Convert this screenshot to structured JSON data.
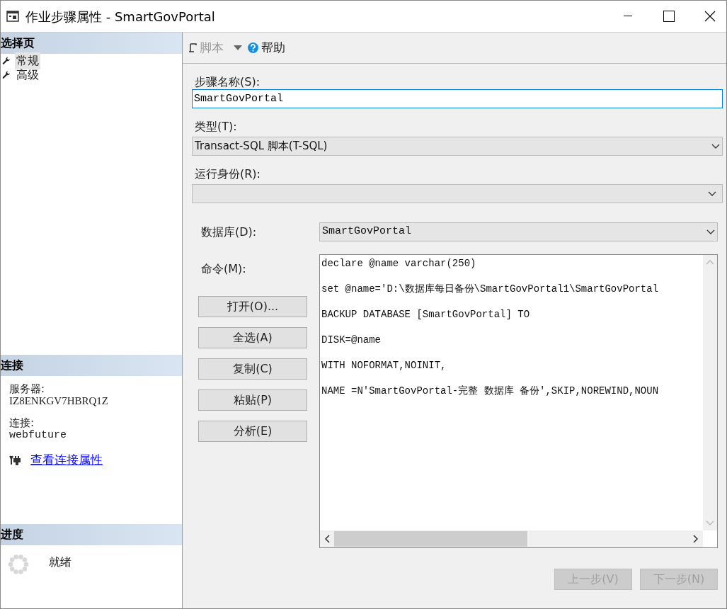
{
  "window": {
    "title": "作业步骤属性 - SmartGovPortal"
  },
  "sidebar": {
    "select_page": {
      "title": "选择页",
      "items": [
        {
          "label": "常规",
          "selected": true
        },
        {
          "label": "高级",
          "selected": false
        }
      ]
    },
    "connection": {
      "title": "连接",
      "server_label": "服务器:",
      "server": "IZ8ENKGV7HBRQ1Z",
      "connection_label": "连接:",
      "connection": "webfuture",
      "link": "查看连接属性"
    },
    "progress": {
      "title": "进度",
      "status": "就绪"
    }
  },
  "toolbar": [
    {
      "kind": "script",
      "label": "脚本",
      "disabled": true
    },
    {
      "kind": "help",
      "label": "帮助",
      "disabled": false
    }
  ],
  "form": {
    "step_name": {
      "label": "步骤名称(S):",
      "value": "SmartGovPortal"
    },
    "type": {
      "label": "类型(T):",
      "value": "Transact-SQL 脚本(T-SQL)"
    },
    "run_as": {
      "label": "运行身份(R):"
    },
    "database": {
      "label": "数据库(D):",
      "value": "SmartGovPortal"
    },
    "command": {
      "label": "命令(M):",
      "lines": [
        "declare @name varchar(250)",
        "set @name='D:\\数据库每日备份\\SmartGovPortal1\\SmartGovPortal",
        "BACKUP DATABASE [SmartGovPortal] TO",
        "DISK=@name",
        "WITH NOFORMAT,NOINIT,",
        "NAME =N'SmartGovPortal-完整 数据库 备份',SKIP,NOREWIND,NOUN"
      ]
    },
    "command_buttons": [
      "打开(O)...",
      "全选(A)",
      "复制(C)",
      "粘贴(P)",
      "分析(E)"
    ]
  },
  "footer_buttons": [
    {
      "label": "上一步(V)",
      "disabled": true
    },
    {
      "label": "下一步(N)",
      "disabled": true
    }
  ]
}
